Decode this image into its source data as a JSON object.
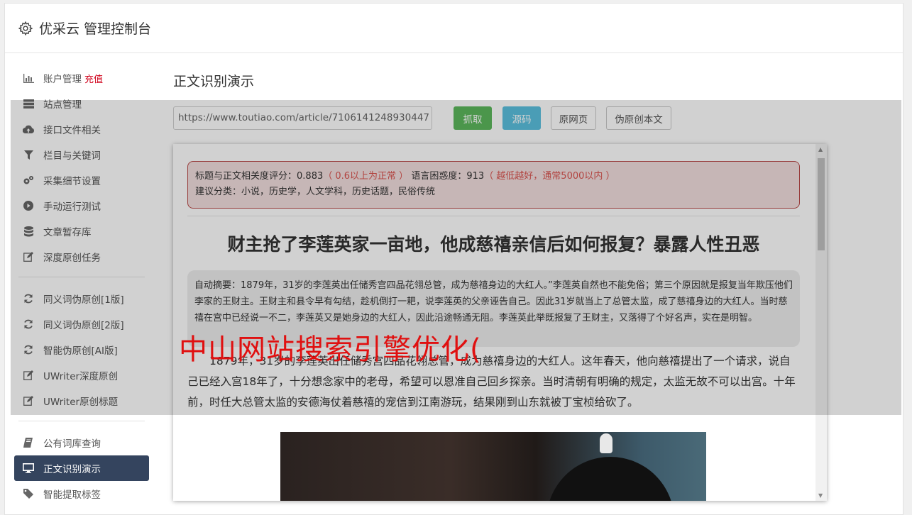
{
  "header": {
    "title": "优采云 管理控制台",
    "icon": "gear-icon"
  },
  "sidebar": {
    "group1": [
      {
        "label": "账户管理",
        "badge": "充值",
        "icon": "bar-chart-icon"
      },
      {
        "label": "站点管理",
        "icon": "server-icon"
      },
      {
        "label": "接口文件相关",
        "icon": "cloud-upload-icon"
      },
      {
        "label": "栏目与关键词",
        "icon": "filter-icon"
      },
      {
        "label": "采集细节设置",
        "icon": "cogs-icon"
      },
      {
        "label": "手动运行测试",
        "icon": "play-circle-icon"
      },
      {
        "label": "文章暂存库",
        "icon": "database-icon"
      },
      {
        "label": "深度原创任务",
        "icon": "edit-icon"
      }
    ],
    "group2": [
      {
        "label": "同义词伪原创[1版]",
        "icon": "refresh-icon"
      },
      {
        "label": "同义词伪原创[2版]",
        "icon": "refresh-icon"
      },
      {
        "label": "智能伪原创[AI版]",
        "icon": "refresh-icon"
      },
      {
        "label": "UWriter深度原创",
        "icon": "edit-icon"
      },
      {
        "label": "UWriter原创标题",
        "icon": "edit-icon"
      }
    ],
    "group3": [
      {
        "label": "公有词库查询",
        "icon": "book-icon"
      },
      {
        "label": "正文识别演示",
        "icon": "monitor-icon",
        "active": true
      },
      {
        "label": "智能提取标签",
        "icon": "tag-icon"
      }
    ]
  },
  "main": {
    "title": "正文识别演示",
    "url_value": "https://www.toutiao.com/article/7106141248930447",
    "buttons": {
      "fetch": "抓取",
      "source": "源码",
      "original": "原网页",
      "rewrite": "伪原创本文"
    }
  },
  "result": {
    "score_label": "标题与正文相关度评分：",
    "score_value": "0.883",
    "score_note": "（ 0.6以上为正常 ）",
    "perplexity_label": "语言困惑度：",
    "perplexity_value": "913",
    "perplexity_note": "（ 越低越好，通常5000以内 ）",
    "category_label": "建议分类：",
    "category_value": "小说，历史学，人文学科，历史话题，民俗传统",
    "article_title": "财主抢了李莲英家一亩地，他成慈禧亲信后如何报复？暴露人性丑恶",
    "summary": "自动摘要：1879年，31岁的李莲英出任储秀宫四品花翎总管，成为慈禧身边的大红人。”李莲英自然也不能免俗；第三个原因就是报复当年欺压他们李家的王财主。王财主和县令早有勾结，趁机倒打一耙，说李莲英的父亲诬告自己。因此31岁就当上了总管太监，成了慈禧身边的大红人。当时慈禧在宫中已经说一不二，李莲英又是她身边的大红人，因此沿途畅通无阻。李莲英此举既报复了王财主，又落得了个好名声，实在是明智。",
    "body": "1879年，31岁的李莲英出任储秀宫四品花翎总管，成为慈禧身边的大红人。这年春天，他向慈禧提出了一个请求，说自己已经入宫18年了，十分想念家中的老母，希望可以恩准自己回乡探亲。当时清朝有明确的规定，太监无故不可以出宫。十年前，时任大总管太监的安德海仗着慈禧的宠信到江南游玩，结果刚到山东就被丁宝桢给砍了。"
  },
  "watermark": "中山网站搜索引擎优化(",
  "colors": {
    "sidebar_active": "#34445e",
    "fetch_btn": "#5cb85c",
    "source_btn": "#5bc0de",
    "alert_red": "#d9534f",
    "watermark": "#e01010"
  }
}
